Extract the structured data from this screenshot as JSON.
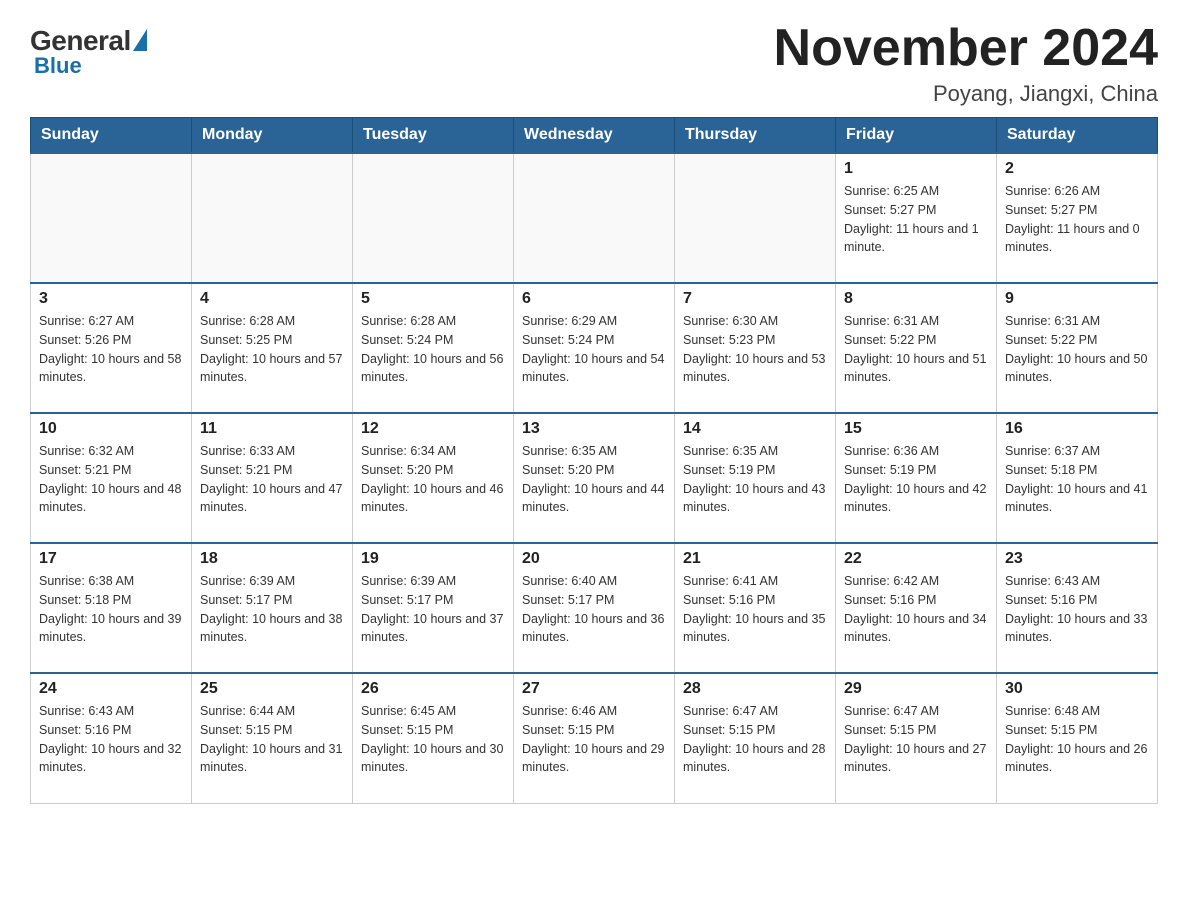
{
  "logo": {
    "general": "General",
    "blue": "Blue"
  },
  "header": {
    "title": "November 2024",
    "subtitle": "Poyang, Jiangxi, China"
  },
  "days_of_week": [
    "Sunday",
    "Monday",
    "Tuesday",
    "Wednesday",
    "Thursday",
    "Friday",
    "Saturday"
  ],
  "weeks": [
    [
      {
        "day": "",
        "info": ""
      },
      {
        "day": "",
        "info": ""
      },
      {
        "day": "",
        "info": ""
      },
      {
        "day": "",
        "info": ""
      },
      {
        "day": "",
        "info": ""
      },
      {
        "day": "1",
        "info": "Sunrise: 6:25 AM\nSunset: 5:27 PM\nDaylight: 11 hours and 1 minute."
      },
      {
        "day": "2",
        "info": "Sunrise: 6:26 AM\nSunset: 5:27 PM\nDaylight: 11 hours and 0 minutes."
      }
    ],
    [
      {
        "day": "3",
        "info": "Sunrise: 6:27 AM\nSunset: 5:26 PM\nDaylight: 10 hours and 58 minutes."
      },
      {
        "day": "4",
        "info": "Sunrise: 6:28 AM\nSunset: 5:25 PM\nDaylight: 10 hours and 57 minutes."
      },
      {
        "day": "5",
        "info": "Sunrise: 6:28 AM\nSunset: 5:24 PM\nDaylight: 10 hours and 56 minutes."
      },
      {
        "day": "6",
        "info": "Sunrise: 6:29 AM\nSunset: 5:24 PM\nDaylight: 10 hours and 54 minutes."
      },
      {
        "day": "7",
        "info": "Sunrise: 6:30 AM\nSunset: 5:23 PM\nDaylight: 10 hours and 53 minutes."
      },
      {
        "day": "8",
        "info": "Sunrise: 6:31 AM\nSunset: 5:22 PM\nDaylight: 10 hours and 51 minutes."
      },
      {
        "day": "9",
        "info": "Sunrise: 6:31 AM\nSunset: 5:22 PM\nDaylight: 10 hours and 50 minutes."
      }
    ],
    [
      {
        "day": "10",
        "info": "Sunrise: 6:32 AM\nSunset: 5:21 PM\nDaylight: 10 hours and 48 minutes."
      },
      {
        "day": "11",
        "info": "Sunrise: 6:33 AM\nSunset: 5:21 PM\nDaylight: 10 hours and 47 minutes."
      },
      {
        "day": "12",
        "info": "Sunrise: 6:34 AM\nSunset: 5:20 PM\nDaylight: 10 hours and 46 minutes."
      },
      {
        "day": "13",
        "info": "Sunrise: 6:35 AM\nSunset: 5:20 PM\nDaylight: 10 hours and 44 minutes."
      },
      {
        "day": "14",
        "info": "Sunrise: 6:35 AM\nSunset: 5:19 PM\nDaylight: 10 hours and 43 minutes."
      },
      {
        "day": "15",
        "info": "Sunrise: 6:36 AM\nSunset: 5:19 PM\nDaylight: 10 hours and 42 minutes."
      },
      {
        "day": "16",
        "info": "Sunrise: 6:37 AM\nSunset: 5:18 PM\nDaylight: 10 hours and 41 minutes."
      }
    ],
    [
      {
        "day": "17",
        "info": "Sunrise: 6:38 AM\nSunset: 5:18 PM\nDaylight: 10 hours and 39 minutes."
      },
      {
        "day": "18",
        "info": "Sunrise: 6:39 AM\nSunset: 5:17 PM\nDaylight: 10 hours and 38 minutes."
      },
      {
        "day": "19",
        "info": "Sunrise: 6:39 AM\nSunset: 5:17 PM\nDaylight: 10 hours and 37 minutes."
      },
      {
        "day": "20",
        "info": "Sunrise: 6:40 AM\nSunset: 5:17 PM\nDaylight: 10 hours and 36 minutes."
      },
      {
        "day": "21",
        "info": "Sunrise: 6:41 AM\nSunset: 5:16 PM\nDaylight: 10 hours and 35 minutes."
      },
      {
        "day": "22",
        "info": "Sunrise: 6:42 AM\nSunset: 5:16 PM\nDaylight: 10 hours and 34 minutes."
      },
      {
        "day": "23",
        "info": "Sunrise: 6:43 AM\nSunset: 5:16 PM\nDaylight: 10 hours and 33 minutes."
      }
    ],
    [
      {
        "day": "24",
        "info": "Sunrise: 6:43 AM\nSunset: 5:16 PM\nDaylight: 10 hours and 32 minutes."
      },
      {
        "day": "25",
        "info": "Sunrise: 6:44 AM\nSunset: 5:15 PM\nDaylight: 10 hours and 31 minutes."
      },
      {
        "day": "26",
        "info": "Sunrise: 6:45 AM\nSunset: 5:15 PM\nDaylight: 10 hours and 30 minutes."
      },
      {
        "day": "27",
        "info": "Sunrise: 6:46 AM\nSunset: 5:15 PM\nDaylight: 10 hours and 29 minutes."
      },
      {
        "day": "28",
        "info": "Sunrise: 6:47 AM\nSunset: 5:15 PM\nDaylight: 10 hours and 28 minutes."
      },
      {
        "day": "29",
        "info": "Sunrise: 6:47 AM\nSunset: 5:15 PM\nDaylight: 10 hours and 27 minutes."
      },
      {
        "day": "30",
        "info": "Sunrise: 6:48 AM\nSunset: 5:15 PM\nDaylight: 10 hours and 26 minutes."
      }
    ]
  ]
}
